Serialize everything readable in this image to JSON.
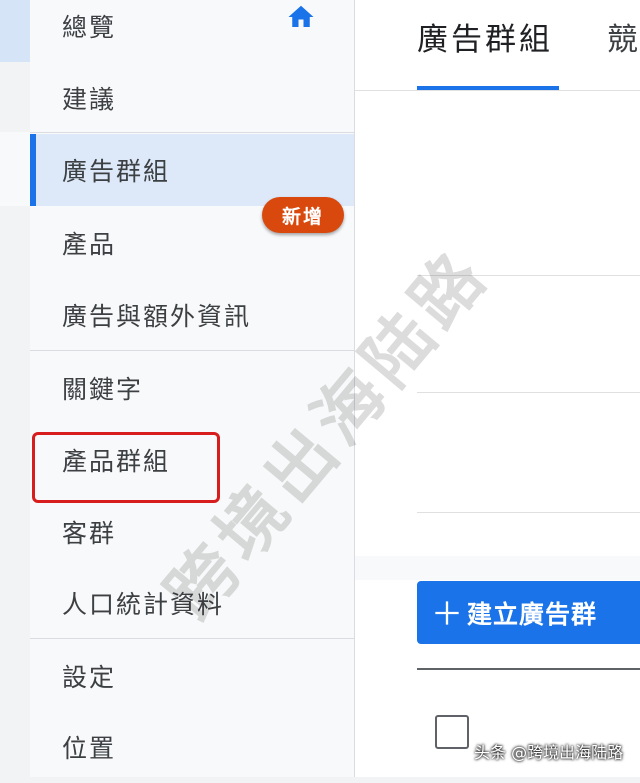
{
  "sidebar": {
    "items": [
      {
        "label": "總覽"
      },
      {
        "label": "建議"
      },
      {
        "label": "廣告群組"
      },
      {
        "label": "產品"
      },
      {
        "label": "廣告與額外資訊"
      },
      {
        "label": "關鍵字"
      },
      {
        "label": "產品群組"
      },
      {
        "label": "客群"
      },
      {
        "label": "人口統計資料"
      },
      {
        "label": "設定"
      },
      {
        "label": "位置"
      }
    ],
    "new_badge": "新增",
    "active_index": 2,
    "highlighted_index": 6
  },
  "main": {
    "tabs": [
      {
        "label": "廣告群組"
      },
      {
        "label": "競"
      }
    ],
    "create_button": {
      "label": "建立廣告群"
    }
  },
  "watermark": "跨境出海陆路",
  "credit": "头条 @跨境出海陆路",
  "colors": {
    "accent": "#1a73e8",
    "badge": "#d9490e",
    "highlight_border": "#d71d1d",
    "active_bg": "#dde8f8"
  },
  "icons": {
    "home": "home-icon",
    "plus": "plus-icon"
  }
}
